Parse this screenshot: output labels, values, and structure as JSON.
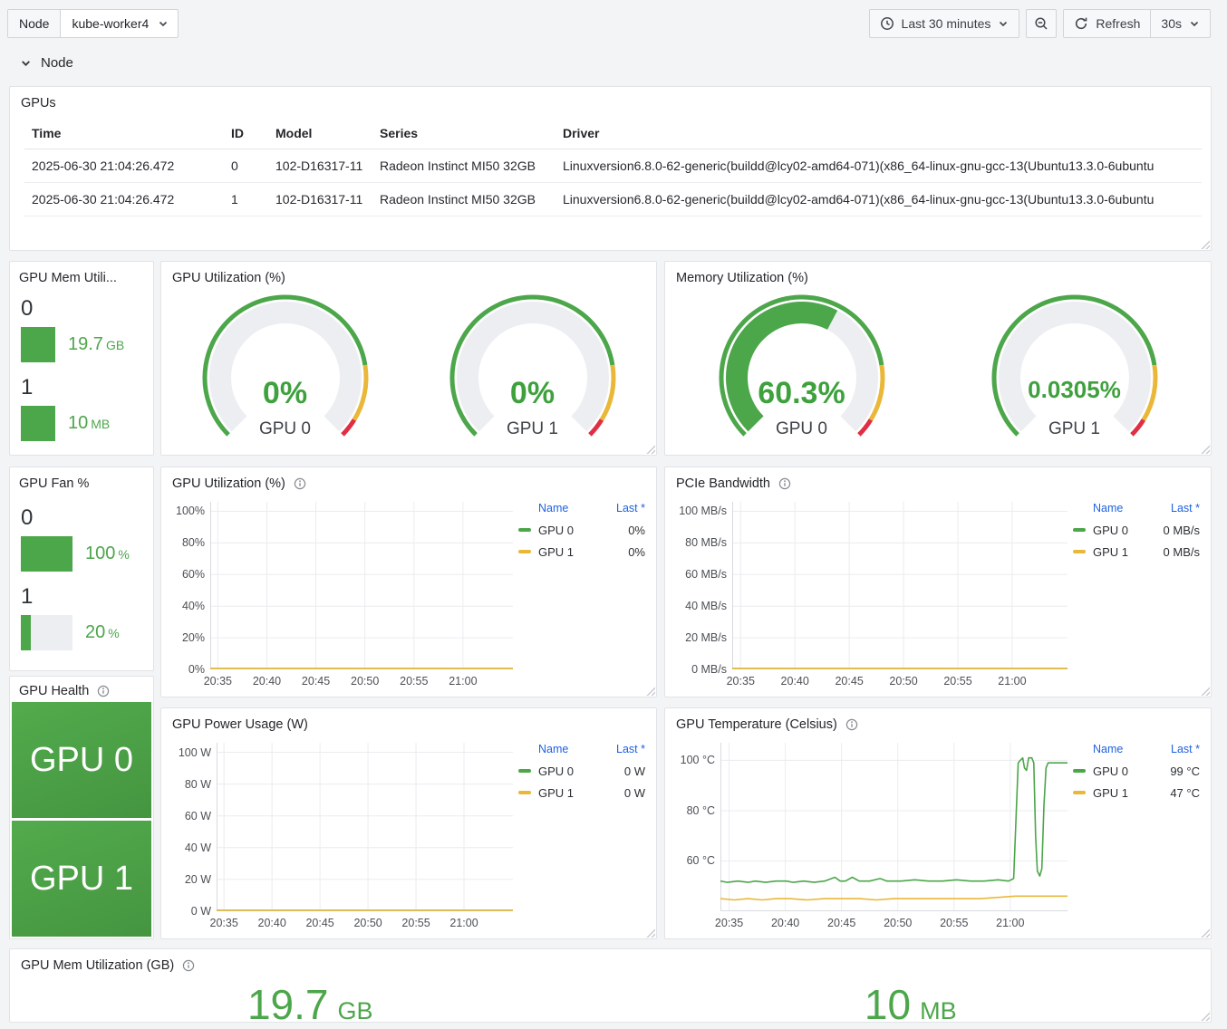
{
  "colors": {
    "green": "#4ca64a",
    "yellow": "#eab839",
    "red": "#e02f44",
    "blue": "#1f62e0",
    "gauge_track": "#eceef1"
  },
  "topbar": {
    "variable_label": "Node",
    "variable_value": "kube-worker4",
    "time_range_label": "Last 30 minutes",
    "refresh_label": "Refresh",
    "refresh_interval": "30s"
  },
  "section": {
    "title": "Node"
  },
  "gpus_table": {
    "title": "GPUs",
    "columns": [
      "Time",
      "ID",
      "Model",
      "Series",
      "Driver"
    ],
    "rows": [
      {
        "time": "2025-06-30 21:04:26.472",
        "id": "0",
        "model": "102-D16317-11",
        "series": "Radeon Instinct MI50 32GB",
        "driver": "Linuxversion6.8.0-62-generic(buildd@lcy02-amd64-071)(x86_64-linux-gnu-gcc-13(Ubuntu13.3.0-6ubuntu"
      },
      {
        "time": "2025-06-30 21:04:26.472",
        "id": "1",
        "model": "102-D16317-11",
        "series": "Radeon Instinct MI50 32GB",
        "driver": "Linuxversion6.8.0-62-generic(buildd@lcy02-amd64-071)(x86_64-linux-gnu-gcc-13(Ubuntu13.3.0-6ubuntu"
      }
    ]
  },
  "panels": {
    "gpu_mem_bars": {
      "title": "GPU Mem Utili...",
      "items": [
        {
          "label": "0",
          "value": "19.7",
          "unit": "GB",
          "pct": 100
        },
        {
          "label": "1",
          "value": "10",
          "unit": "MB",
          "pct": 100
        }
      ]
    },
    "gpu_fan": {
      "title": "GPU Fan %",
      "items": [
        {
          "label": "0",
          "value": "100",
          "unit": "%",
          "pct": 100
        },
        {
          "label": "1",
          "value": "20",
          "unit": "%",
          "pct": 20
        }
      ]
    },
    "gpu_utilization_gauges": {
      "title": "GPU Utilization (%)",
      "gauges": [
        {
          "label": "GPU 0",
          "display": "0%",
          "pct": 0
        },
        {
          "label": "GPU 1",
          "display": "0%",
          "pct": 0
        }
      ]
    },
    "memory_utilization_gauges": {
      "title": "Memory Utilization (%)",
      "gauges": [
        {
          "label": "GPU 0",
          "display": "60.3%",
          "pct": 60.3
        },
        {
          "label": "GPU 1",
          "display": "0.0305%",
          "pct": 0.03
        }
      ]
    },
    "gpu_health": {
      "title": "GPU Health",
      "items": [
        {
          "label": "GPU 0"
        },
        {
          "label": "GPU 1"
        }
      ]
    },
    "gpu_mem_stats": {
      "title": "GPU Mem Utilization (GB)",
      "stats": [
        {
          "value": "19.7",
          "unit": "GB"
        },
        {
          "value": "10",
          "unit": "MB"
        }
      ]
    }
  },
  "charts": {
    "gpu_utilization": {
      "type": "line",
      "title": "GPU Utilization (%)",
      "y_range": [
        0,
        106
      ],
      "y_ticks": [
        {
          "v": 100,
          "label": "100%"
        },
        {
          "v": 80,
          "label": "80%"
        },
        {
          "v": 60,
          "label": "60%"
        },
        {
          "v": 40,
          "label": "40%"
        },
        {
          "v": 20,
          "label": "20%"
        },
        {
          "v": 0,
          "label": "0%"
        }
      ],
      "x_ticks": [
        {
          "pos": 0.025,
          "label": "20:35"
        },
        {
          "pos": 0.187,
          "label": "20:40"
        },
        {
          "pos": 0.349,
          "label": "20:45"
        },
        {
          "pos": 0.511,
          "label": "20:50"
        },
        {
          "pos": 0.673,
          "label": "20:55"
        },
        {
          "pos": 0.835,
          "label": "21:00"
        }
      ],
      "legend_headers": {
        "name": "Name",
        "last": "Last *"
      },
      "series": [
        {
          "name": "GPU 0",
          "color": "#4ca64a",
          "last": "0%",
          "points": [
            [
              0,
              0
            ],
            [
              1,
              0
            ]
          ]
        },
        {
          "name": "GPU 1",
          "color": "#eab839",
          "last": "0%",
          "points": [
            [
              0,
              0
            ],
            [
              1,
              0
            ]
          ]
        }
      ]
    },
    "pcie_bandwidth": {
      "type": "line",
      "title": "PCIe Bandwidth",
      "y_range": [
        0,
        106
      ],
      "y_ticks": [
        {
          "v": 100,
          "label": "100 MB/s"
        },
        {
          "v": 80,
          "label": "80 MB/s"
        },
        {
          "v": 60,
          "label": "60 MB/s"
        },
        {
          "v": 40,
          "label": "40 MB/s"
        },
        {
          "v": 20,
          "label": "20 MB/s"
        },
        {
          "v": 0,
          "label": "0 MB/s"
        }
      ],
      "x_ticks": [
        {
          "pos": 0.025,
          "label": "20:35"
        },
        {
          "pos": 0.187,
          "label": "20:40"
        },
        {
          "pos": 0.349,
          "label": "20:45"
        },
        {
          "pos": 0.511,
          "label": "20:50"
        },
        {
          "pos": 0.673,
          "label": "20:55"
        },
        {
          "pos": 0.835,
          "label": "21:00"
        }
      ],
      "legend_headers": {
        "name": "Name",
        "last": "Last *"
      },
      "series": [
        {
          "name": "GPU 0",
          "color": "#4ca64a",
          "last": "0 MB/s",
          "points": [
            [
              0,
              0
            ],
            [
              1,
              0
            ]
          ]
        },
        {
          "name": "GPU 1",
          "color": "#eab839",
          "last": "0 MB/s",
          "points": [
            [
              0,
              0
            ],
            [
              1,
              0
            ]
          ]
        }
      ]
    },
    "gpu_power": {
      "type": "line",
      "title": "GPU Power Usage (W)",
      "y_range": [
        0,
        106
      ],
      "y_ticks": [
        {
          "v": 100,
          "label": "100 W"
        },
        {
          "v": 80,
          "label": "80 W"
        },
        {
          "v": 60,
          "label": "60 W"
        },
        {
          "v": 40,
          "label": "40 W"
        },
        {
          "v": 20,
          "label": "20 W"
        },
        {
          "v": 0,
          "label": "0 W"
        }
      ],
      "x_ticks": [
        {
          "pos": 0.025,
          "label": "20:35"
        },
        {
          "pos": 0.187,
          "label": "20:40"
        },
        {
          "pos": 0.349,
          "label": "20:45"
        },
        {
          "pos": 0.511,
          "label": "20:50"
        },
        {
          "pos": 0.673,
          "label": "20:55"
        },
        {
          "pos": 0.835,
          "label": "21:00"
        }
      ],
      "legend_headers": {
        "name": "Name",
        "last": "Last *"
      },
      "series": [
        {
          "name": "GPU 0",
          "color": "#4ca64a",
          "last": "0 W",
          "points": [
            [
              0,
              0
            ],
            [
              1,
              0
            ]
          ]
        },
        {
          "name": "GPU 1",
          "color": "#eab839",
          "last": "0 W",
          "points": [
            [
              0,
              0
            ],
            [
              1,
              0
            ]
          ]
        }
      ]
    },
    "gpu_temperature": {
      "type": "line",
      "title": "GPU Temperature (Celsius)",
      "y_range": [
        40,
        107
      ],
      "y_ticks": [
        {
          "v": 100,
          "label": "100 °C"
        },
        {
          "v": 80,
          "label": "80 °C"
        },
        {
          "v": 60,
          "label": "60 °C"
        }
      ],
      "x_ticks": [
        {
          "pos": 0.025,
          "label": "20:35"
        },
        {
          "pos": 0.187,
          "label": "20:40"
        },
        {
          "pos": 0.349,
          "label": "20:45"
        },
        {
          "pos": 0.511,
          "label": "20:50"
        },
        {
          "pos": 0.673,
          "label": "20:55"
        },
        {
          "pos": 0.835,
          "label": "21:00"
        }
      ],
      "legend_headers": {
        "name": "Name",
        "last": "Last *"
      },
      "series": [
        {
          "name": "GPU 0",
          "color": "#4ca64a",
          "last": "99 °C",
          "points": [
            [
              0,
              52
            ],
            [
              0.02,
              51.5
            ],
            [
              0.05,
              52
            ],
            [
              0.08,
              51.5
            ],
            [
              0.1,
              52
            ],
            [
              0.13,
              51.5
            ],
            [
              0.16,
              52
            ],
            [
              0.19,
              52
            ],
            [
              0.21,
              51.5
            ],
            [
              0.24,
              52
            ],
            [
              0.27,
              51.5
            ],
            [
              0.3,
              52
            ],
            [
              0.33,
              53.5
            ],
            [
              0.345,
              52
            ],
            [
              0.36,
              52
            ],
            [
              0.38,
              53.5
            ],
            [
              0.4,
              52
            ],
            [
              0.43,
              52
            ],
            [
              0.46,
              53
            ],
            [
              0.48,
              52
            ],
            [
              0.52,
              52
            ],
            [
              0.56,
              52.5
            ],
            [
              0.6,
              52
            ],
            [
              0.64,
              52
            ],
            [
              0.68,
              52.5
            ],
            [
              0.72,
              52
            ],
            [
              0.76,
              52
            ],
            [
              0.8,
              52.5
            ],
            [
              0.83,
              52
            ],
            [
              0.845,
              53
            ],
            [
              0.852,
              78
            ],
            [
              0.858,
              99
            ],
            [
              0.864,
              100
            ],
            [
              0.871,
              101
            ],
            [
              0.876,
              97
            ],
            [
              0.882,
              96
            ],
            [
              0.888,
              101
            ],
            [
              0.897,
              101
            ],
            [
              0.903,
              99
            ],
            [
              0.908,
              70
            ],
            [
              0.913,
              56
            ],
            [
              0.92,
              54
            ],
            [
              0.926,
              57
            ],
            [
              0.932,
              82
            ],
            [
              0.938,
              97
            ],
            [
              0.944,
              99
            ],
            [
              0.96,
              99
            ],
            [
              0.98,
              99
            ],
            [
              1,
              99
            ]
          ]
        },
        {
          "name": "GPU 1",
          "color": "#eab839",
          "last": "47 °C",
          "points": [
            [
              0,
              45
            ],
            [
              0.04,
              44.5
            ],
            [
              0.08,
              45
            ],
            [
              0.12,
              44.5
            ],
            [
              0.16,
              45
            ],
            [
              0.2,
              45
            ],
            [
              0.25,
              44.5
            ],
            [
              0.3,
              45
            ],
            [
              0.35,
              45
            ],
            [
              0.4,
              45
            ],
            [
              0.45,
              44.5
            ],
            [
              0.5,
              45
            ],
            [
              0.55,
              45
            ],
            [
              0.6,
              45
            ],
            [
              0.65,
              45
            ],
            [
              0.7,
              45
            ],
            [
              0.75,
              45
            ],
            [
              0.8,
              45.5
            ],
            [
              0.85,
              46
            ],
            [
              0.9,
              46
            ],
            [
              0.95,
              46
            ],
            [
              1,
              46
            ]
          ]
        }
      ]
    }
  }
}
